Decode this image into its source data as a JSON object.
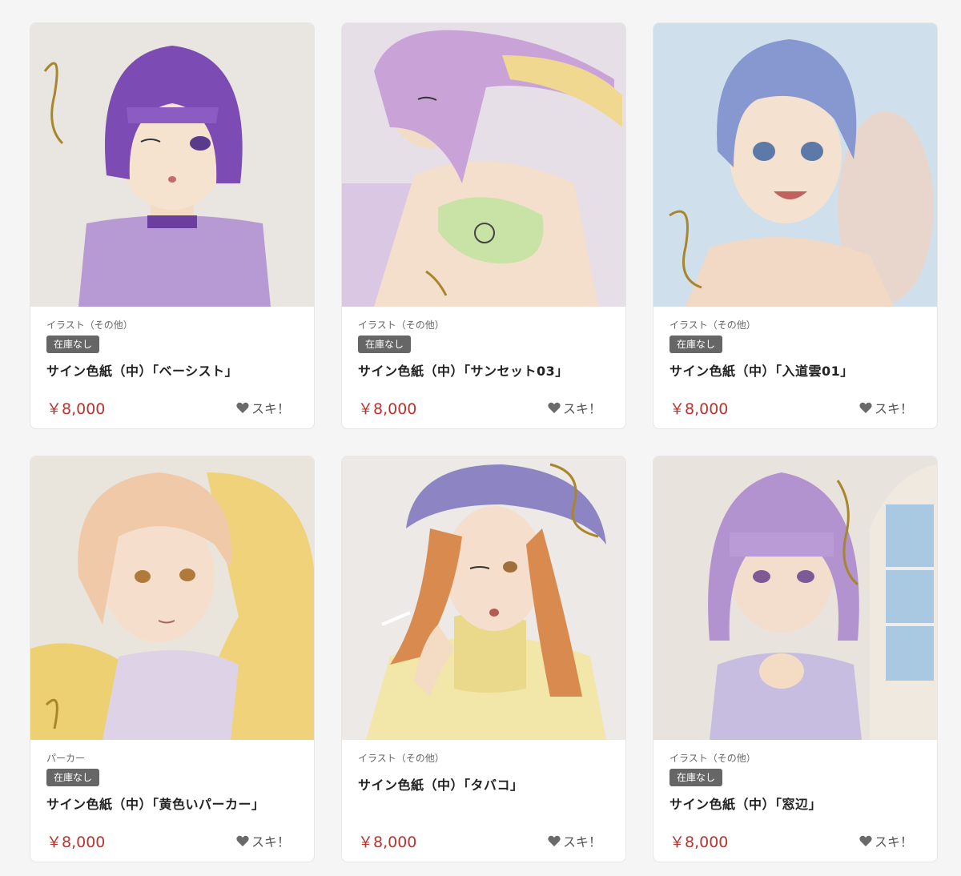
{
  "colors": {
    "price": "#b8352f",
    "badge_bg": "#666666",
    "card_bg": "#ffffff",
    "page_bg": "#f5f5f5"
  },
  "products": [
    {
      "category": "イラスト（その他）",
      "badge": "在庫なし",
      "title": "サイン色紙（中）「ベーシスト」",
      "price": "￥8,000",
      "like_label": "スキ！",
      "image": "illustration-purple-bob-hair-woman"
    },
    {
      "category": "イラスト（その他）",
      "badge": "在庫なし",
      "title": "サイン色紙（中）「サンセット03」",
      "price": "￥8,000",
      "like_label": "スキ！",
      "image": "illustration-lavender-hair-bikini-woman"
    },
    {
      "category": "イラスト（その他）",
      "badge": "在庫なし",
      "title": "サイン色紙（中）「入道雲01」",
      "price": "￥8,000",
      "like_label": "スキ！",
      "image": "illustration-blue-hair-waving-woman"
    },
    {
      "category": "パーカー",
      "badge": "在庫なし",
      "title": "サイン色紙（中）「黄色いパーカー」",
      "price": "￥8,000",
      "like_label": "スキ！",
      "image": "illustration-yellow-hoodie-woman"
    },
    {
      "category": "イラスト（その他）",
      "badge": "",
      "title": "サイン色紙（中）「タバコ」",
      "price": "￥8,000",
      "like_label": "スキ！",
      "image": "illustration-beanie-cigarette-woman"
    },
    {
      "category": "イラスト（その他）",
      "badge": "在庫なし",
      "title": "サイン色紙（中）「窓辺」",
      "price": "￥8,000",
      "like_label": "スキ！",
      "image": "illustration-window-side-woman"
    }
  ]
}
